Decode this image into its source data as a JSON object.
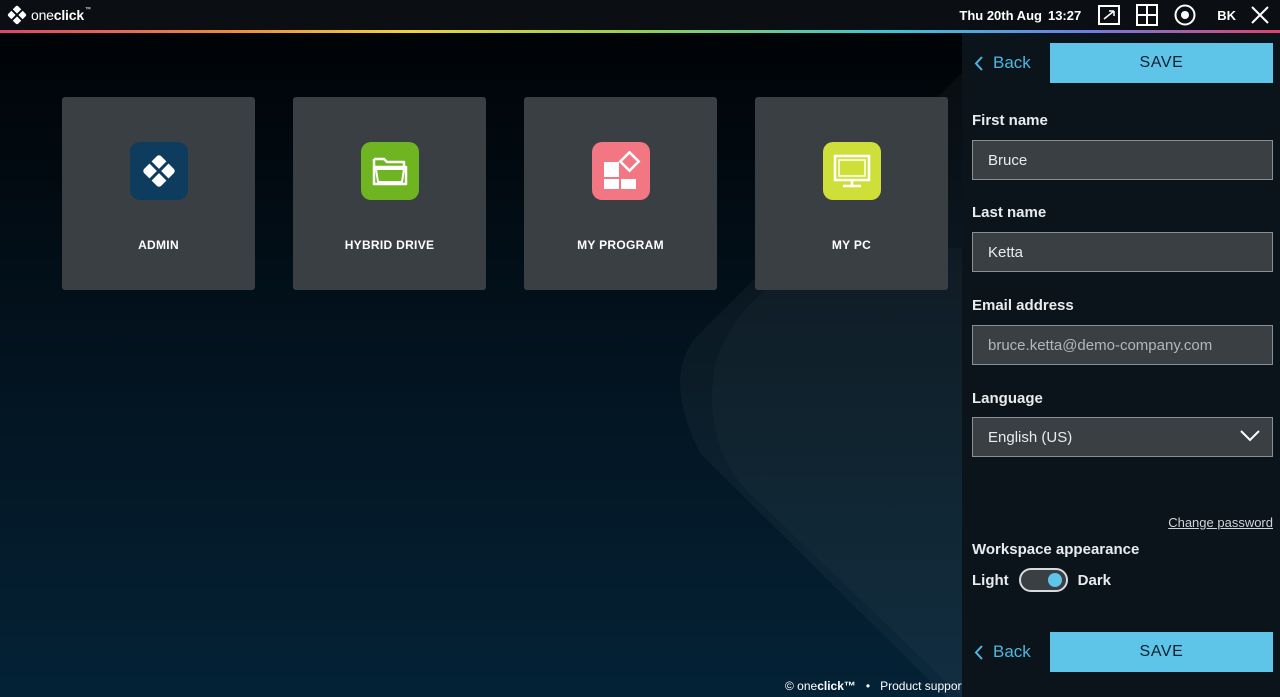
{
  "app": {
    "logo_prefix": "one",
    "logo_bold": "click",
    "logo_tm": "™"
  },
  "topbar": {
    "date": "Thu 20th Aug",
    "time": "13:27",
    "icons": [
      "window-icon",
      "grid-icon",
      "record-icon"
    ],
    "user_initials": "BK"
  },
  "tiles": [
    {
      "label": "ADMIN",
      "icon": "admin-diamond-icon",
      "color": "#0e3c5e"
    },
    {
      "label": "HYBRID DRIVE",
      "icon": "folder-icon",
      "color": "#6fb521"
    },
    {
      "label": "MY PROGRAM",
      "icon": "apps-icon",
      "color": "#f27782"
    },
    {
      "label": "MY PC",
      "icon": "monitor-icon",
      "color": "#cfdf3a"
    }
  ],
  "footer": {
    "brand_prefix": "© one",
    "brand_bold": "click™",
    "link": "Product support"
  },
  "panel": {
    "back_label": "Back",
    "save_label": "SAVE",
    "first_name_label": "First name",
    "first_name_value": "Bruce",
    "last_name_label": "Last name",
    "last_name_value": "Ketta",
    "email_label": "Email address",
    "email_value": "bruce.ketta@demo-company.com",
    "language_label": "Language",
    "language_value": "English (US)",
    "change_password": "Change password",
    "appearance_label": "Workspace appearance",
    "toggle_left": "Light",
    "toggle_right": "Dark",
    "toggle_state": "Dark"
  },
  "colors": {
    "accent": "#5ec4e8",
    "link": "#4fb6e0",
    "tile_bg": "#3a3f44"
  }
}
